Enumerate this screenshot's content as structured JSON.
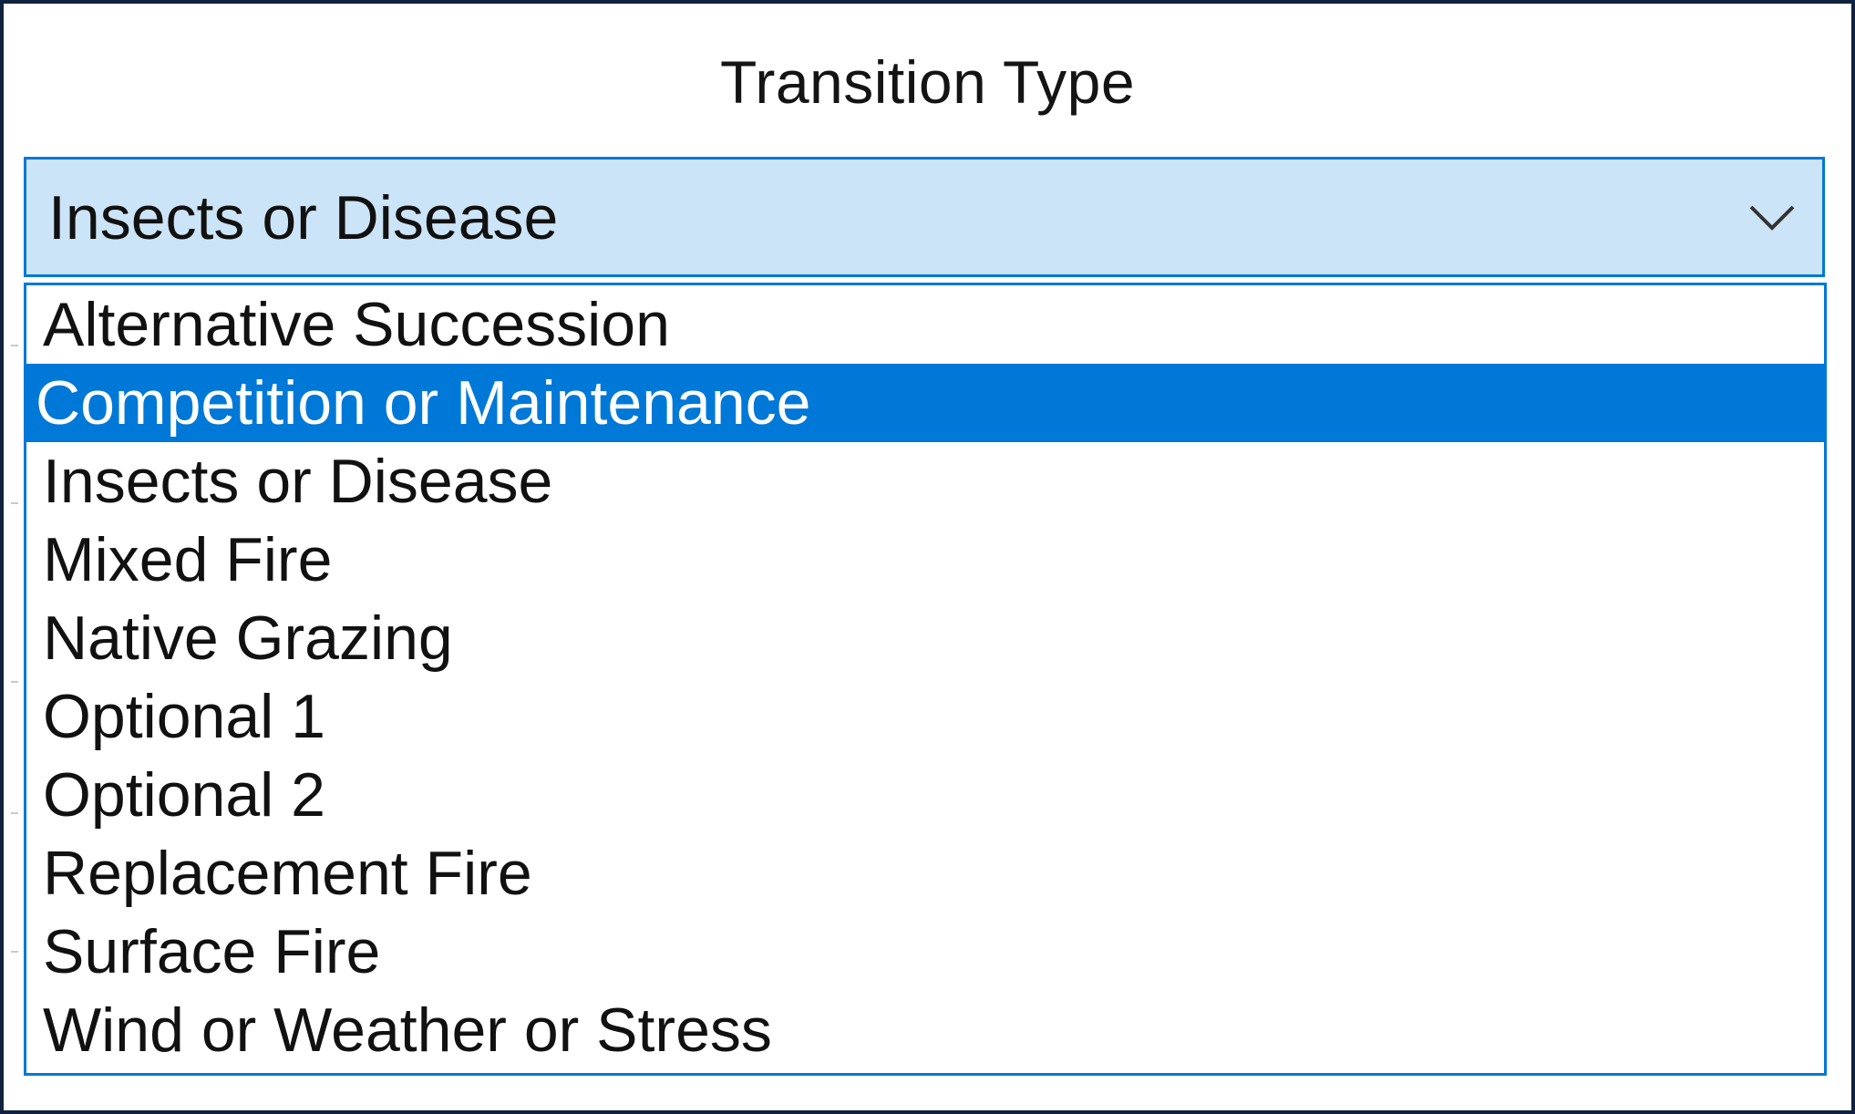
{
  "header": {
    "title": "Transition Type"
  },
  "combo": {
    "value": "Insects or Disease",
    "icon": "chevron-down-icon"
  },
  "dropdown": {
    "selected_index": 1,
    "options": [
      {
        "label": "Alternative Succession"
      },
      {
        "label": "Competition or Maintenance"
      },
      {
        "label": "Insects or Disease"
      },
      {
        "label": "Mixed Fire"
      },
      {
        "label": "Native Grazing"
      },
      {
        "label": "Optional 1"
      },
      {
        "label": "Optional 2"
      },
      {
        "label": "Replacement Fire"
      },
      {
        "label": "Surface Fire"
      },
      {
        "label": "Wind or Weather or Stress"
      }
    ]
  },
  "colors": {
    "frame": "#0f2240",
    "accent": "#0078d7",
    "combo_background": "#cce4f7",
    "selected_text": "#ffffff"
  }
}
